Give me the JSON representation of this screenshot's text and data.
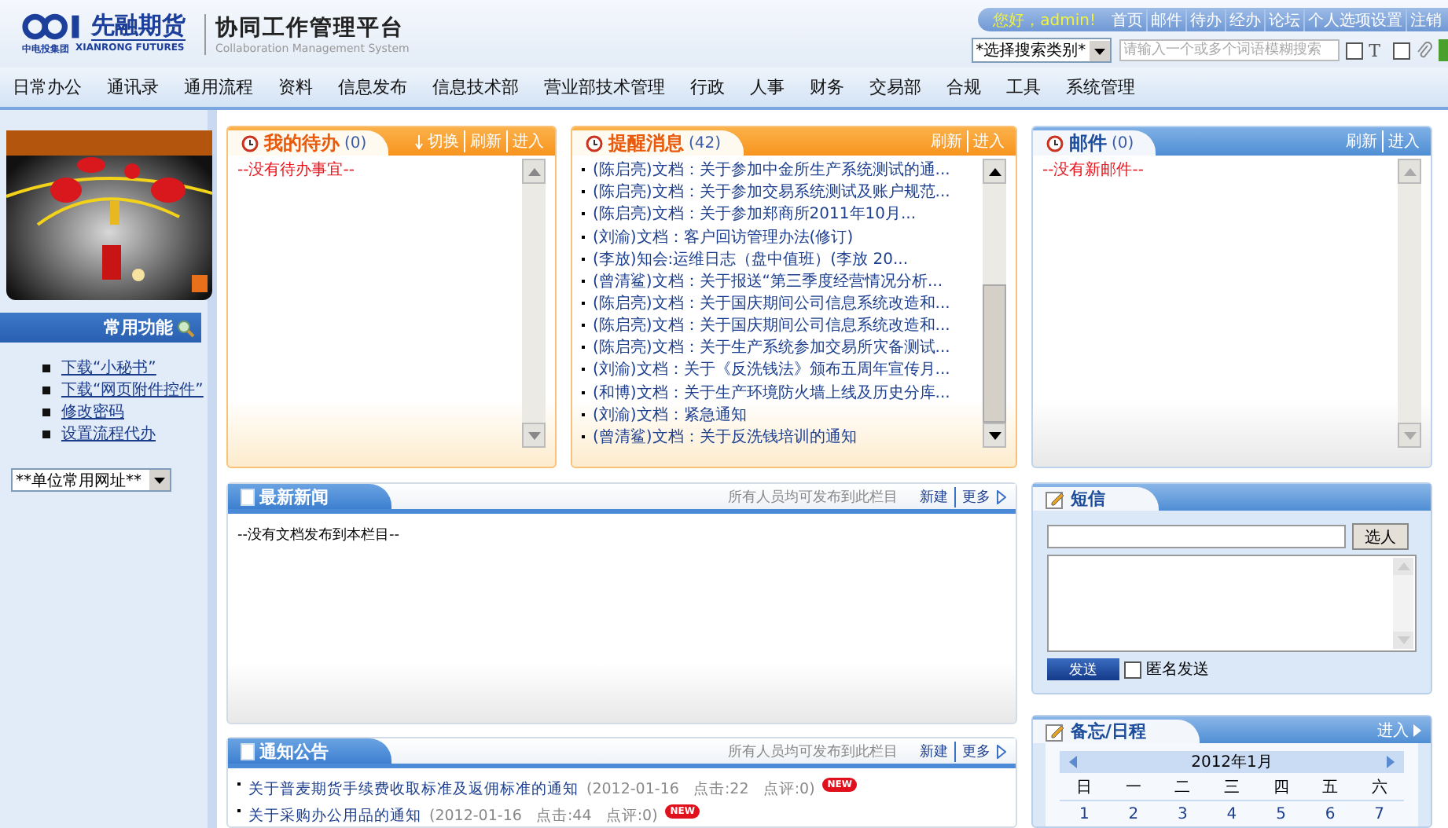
{
  "header": {
    "logo": {
      "name": "先融期货",
      "group": "中电投集团",
      "english": "XIANRONG FUTURES"
    },
    "title": "协同工作管理平台",
    "subtitle": "Collaboration Management System",
    "greeting": "您好，admin!",
    "links": [
      "首页",
      "邮件",
      "待办",
      "经办",
      "论坛",
      "个人选项设置",
      "注销"
    ],
    "search": {
      "category": "*选择搜索类别*",
      "placeholder": "请输入一个或多个词语模糊搜索",
      "options": [
        {
          "kind": "title",
          "label": "T",
          "checked": false
        },
        {
          "kind": "attachment",
          "checked": false
        }
      ]
    }
  },
  "nav": [
    "日常办公",
    "通讯录",
    "通用流程",
    "资料",
    "信息发布",
    "信息技术部",
    "营业部技术管理",
    "行政",
    "人事",
    "财务",
    "交易部",
    "合规",
    "工具",
    "系统管理"
  ],
  "sidebar": {
    "title": "常用功能",
    "links": [
      "下载“小秘书”",
      "下载“网页附件控件”",
      "修改密码",
      "设置流程代办"
    ],
    "select": "**单位常用网址**"
  },
  "todo": {
    "title": "我的待办",
    "count": "(0)",
    "actions": [
      {
        "kind": "switch",
        "label": "切换"
      },
      {
        "kind": "plain",
        "label": "刷新"
      },
      {
        "kind": "plain",
        "label": "进入"
      }
    ],
    "empty": "--没有待办事宜--"
  },
  "reminders": {
    "title": "提醒消息",
    "count": "(42)",
    "actions": [
      "刷新",
      "进入"
    ],
    "items": [
      "(陈启亮)文档：关于参加中金所生产系统测试的通...",
      "(陈启亮)文档：关于参加交易系统测试及账户规范...",
      "(陈启亮)文档：关于参加郑商所2011年10月...",
      "(刘渝)文档：客户回访管理办法(修订)",
      "(李放)知会:运维日志（盘中值班）(李放 20...",
      "(曾清鲨)文档：关于报送“第三季度经营情况分析...",
      "(陈启亮)文档：关于国庆期间公司信息系统改造和...",
      "(陈启亮)文档：关于国庆期间公司信息系统改造和...",
      "(陈启亮)文档：关于生产系统参加交易所灾备测试...",
      "(刘渝)文档：关于《反洗钱法》颁布五周年宣传月...",
      "(和博)文档：关于生产环境防火墙上线及历史分库...",
      "(刘渝)文档：紧急通知",
      "(曾清鲨)文档：关于反洗钱培训的通知"
    ]
  },
  "mail": {
    "title": "邮件",
    "count": "(0)",
    "actions": [
      "刷新",
      "进入"
    ],
    "empty": "--没有新邮件--"
  },
  "news": {
    "title": "最新新闻",
    "note": "所有人员均可发布到此栏目",
    "actions": [
      "新建",
      "更多"
    ],
    "empty": "--没有文档发布到本栏目--"
  },
  "notices": {
    "title": "通知公告",
    "note": "所有人员均可发布到此栏目",
    "actions": [
      "新建",
      "更多"
    ],
    "items": [
      {
        "title": "关于普麦期货手续费收取标准及返佣标准的通知",
        "meta": "(2012-01-16   点击:22   点评:0)",
        "badge": "NEW"
      },
      {
        "title": "关于采购办公用品的通知",
        "meta": "(2012-01-16   点击:44   点评:0)",
        "badge": "NEW"
      }
    ]
  },
  "sms": {
    "title": "短信",
    "pick": "选人",
    "send": "发送",
    "anonymous": {
      "label": "匿名发送",
      "checked": false
    }
  },
  "calendar": {
    "title": "备忘/日程",
    "enter": "进入",
    "month": "2012年1月",
    "weekdays": [
      "日",
      "一",
      "二",
      "三",
      "四",
      "五",
      "六"
    ],
    "days": [
      "1",
      "2",
      "3",
      "4",
      "5",
      "6",
      "7"
    ]
  }
}
